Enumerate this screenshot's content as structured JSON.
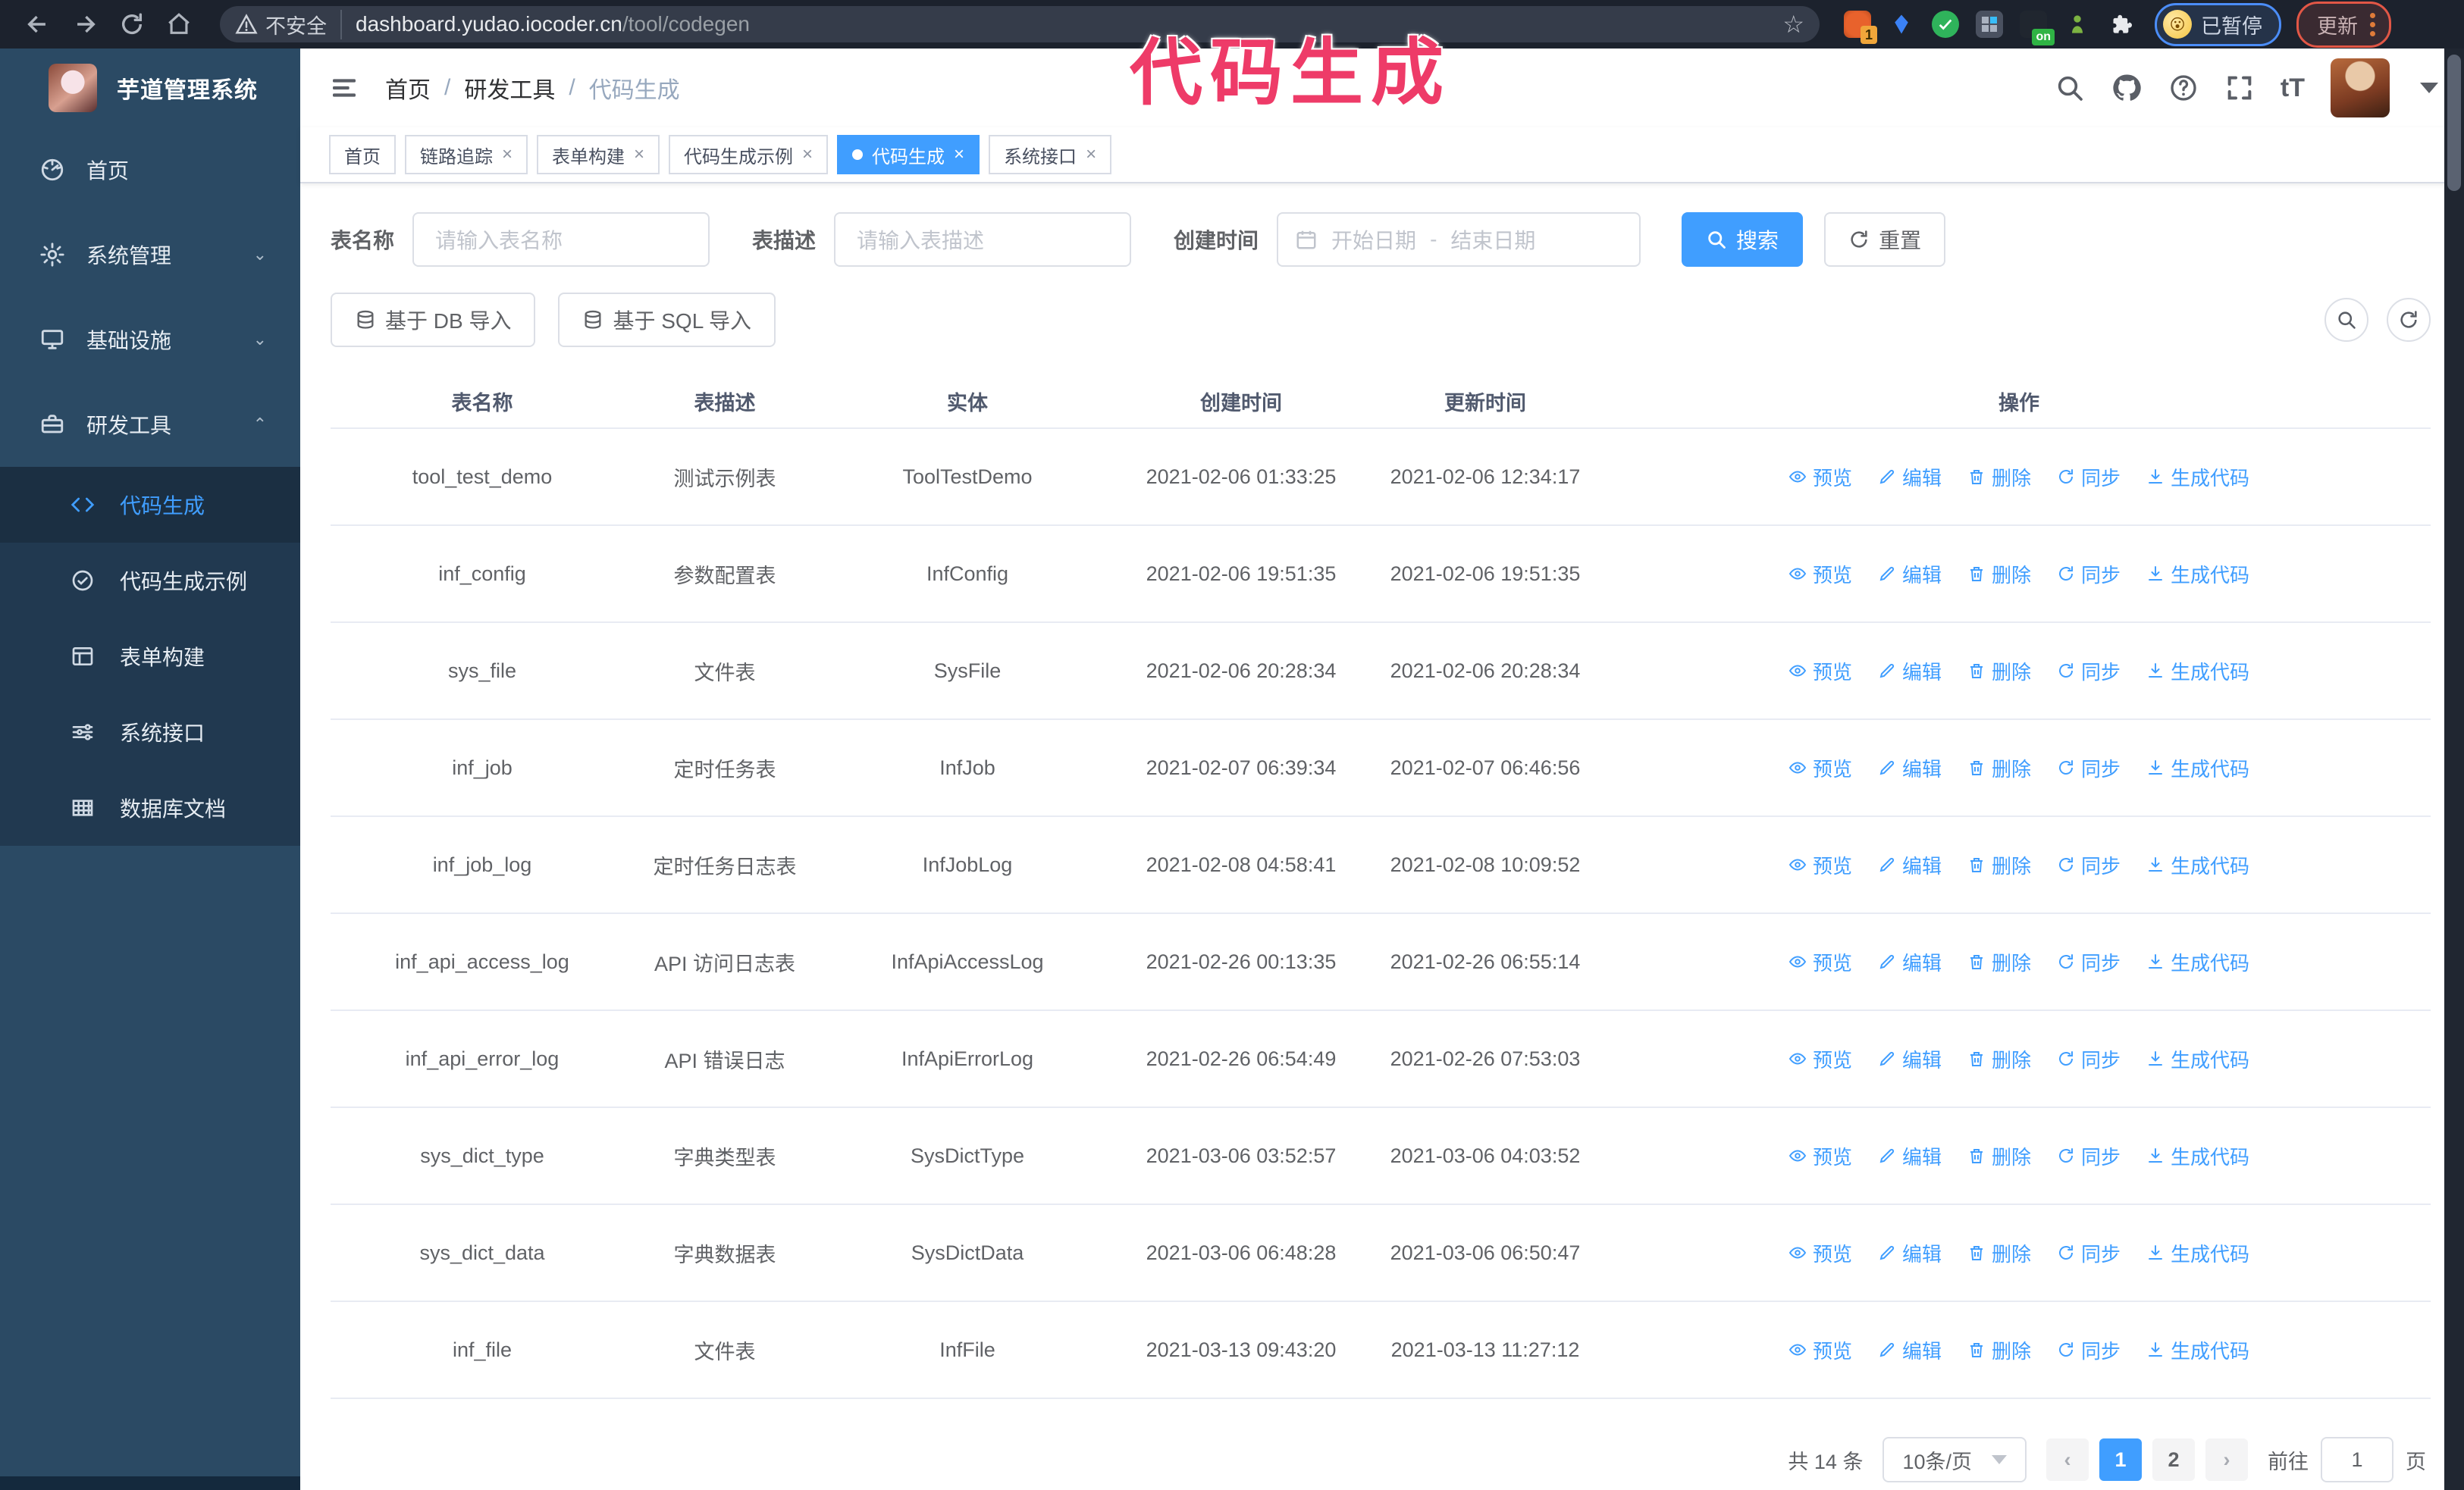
{
  "browser": {
    "security_warning": "不安全",
    "url_host": "dashboard.yudao.iocoder.cn",
    "url_path": "/tool/codegen",
    "extension_badge_count": "1",
    "extension_on_badge": "on",
    "paused_badge": "已暂停",
    "update_button": "更新"
  },
  "annotation": {
    "text": "代码生成",
    "color": "#ee3b68"
  },
  "sidebar": {
    "app_title": "芋道管理系统",
    "items": [
      {
        "label": "首页"
      },
      {
        "label": "系统管理"
      },
      {
        "label": "基础设施"
      },
      {
        "label": "研发工具"
      }
    ],
    "submenu": [
      {
        "label": "代码生成"
      },
      {
        "label": "代码生成示例"
      },
      {
        "label": "表单构建"
      },
      {
        "label": "系统接口"
      },
      {
        "label": "数据库文档"
      }
    ]
  },
  "header": {
    "breadcrumb": [
      "首页",
      "研发工具",
      "代码生成"
    ],
    "separator": "/"
  },
  "tabs": [
    {
      "label": "首页"
    },
    {
      "label": "链路追踪"
    },
    {
      "label": "表单构建"
    },
    {
      "label": "代码生成示例"
    },
    {
      "label": "代码生成"
    },
    {
      "label": "系统接口"
    }
  ],
  "filters": {
    "table_name_label": "表名称",
    "table_name_placeholder": "请输入表名称",
    "table_desc_label": "表描述",
    "table_desc_placeholder": "请输入表描述",
    "create_time_label": "创建时间",
    "date_start_placeholder": "开始日期",
    "date_separator": "-",
    "date_end_placeholder": "结束日期",
    "search_label": "搜索",
    "reset_label": "重置"
  },
  "toolbar": {
    "import_db_label": "基于 DB 导入",
    "import_sql_label": "基于 SQL 导入"
  },
  "table": {
    "columns": [
      "表名称",
      "表描述",
      "实体",
      "创建时间",
      "更新时间",
      "操作"
    ],
    "actions": [
      "预览",
      "编辑",
      "删除",
      "同步",
      "生成代码"
    ],
    "rows": [
      {
        "name": "tool_test_demo",
        "desc": "测试示例表",
        "entity": "ToolTestDemo",
        "created": "2021-02-06 01:33:25",
        "updated": "2021-02-06 12:34:17"
      },
      {
        "name": "inf_config",
        "desc": "参数配置表",
        "entity": "InfConfig",
        "created": "2021-02-06 19:51:35",
        "updated": "2021-02-06 19:51:35"
      },
      {
        "name": "sys_file",
        "desc": "文件表",
        "entity": "SysFile",
        "created": "2021-02-06 20:28:34",
        "updated": "2021-02-06 20:28:34"
      },
      {
        "name": "inf_job",
        "desc": "定时任务表",
        "entity": "InfJob",
        "created": "2021-02-07 06:39:34",
        "updated": "2021-02-07 06:46:56"
      },
      {
        "name": "inf_job_log",
        "desc": "定时任务日志表",
        "entity": "InfJobLog",
        "created": "2021-02-08 04:58:41",
        "updated": "2021-02-08 10:09:52"
      },
      {
        "name": "inf_api_access_log",
        "desc": "API 访问日志表",
        "entity": "InfApiAccessLog",
        "created": "2021-02-26 00:13:35",
        "updated": "2021-02-26 06:55:14"
      },
      {
        "name": "inf_api_error_log",
        "desc": "API 错误日志",
        "entity": "InfApiErrorLog",
        "created": "2021-02-26 06:54:49",
        "updated": "2021-02-26 07:53:03"
      },
      {
        "name": "sys_dict_type",
        "desc": "字典类型表",
        "entity": "SysDictType",
        "created": "2021-03-06 03:52:57",
        "updated": "2021-03-06 04:03:52"
      },
      {
        "name": "sys_dict_data",
        "desc": "字典数据表",
        "entity": "SysDictData",
        "created": "2021-03-06 06:48:28",
        "updated": "2021-03-06 06:50:47"
      },
      {
        "name": "inf_file",
        "desc": "文件表",
        "entity": "InfFile",
        "created": "2021-03-13 09:43:20",
        "updated": "2021-03-13 11:27:12"
      }
    ]
  },
  "pagination": {
    "total_text": "共 14 条",
    "page_size": "10条/页",
    "pages": [
      "1",
      "2"
    ],
    "active_page": "1",
    "goto_label": "前往",
    "goto_value": "1",
    "page_suffix": "页"
  },
  "colors": {
    "primary": "#409EFF",
    "sidebar": "#2b4a64",
    "submenu": "#213950",
    "annotation": "#ee3b68"
  }
}
